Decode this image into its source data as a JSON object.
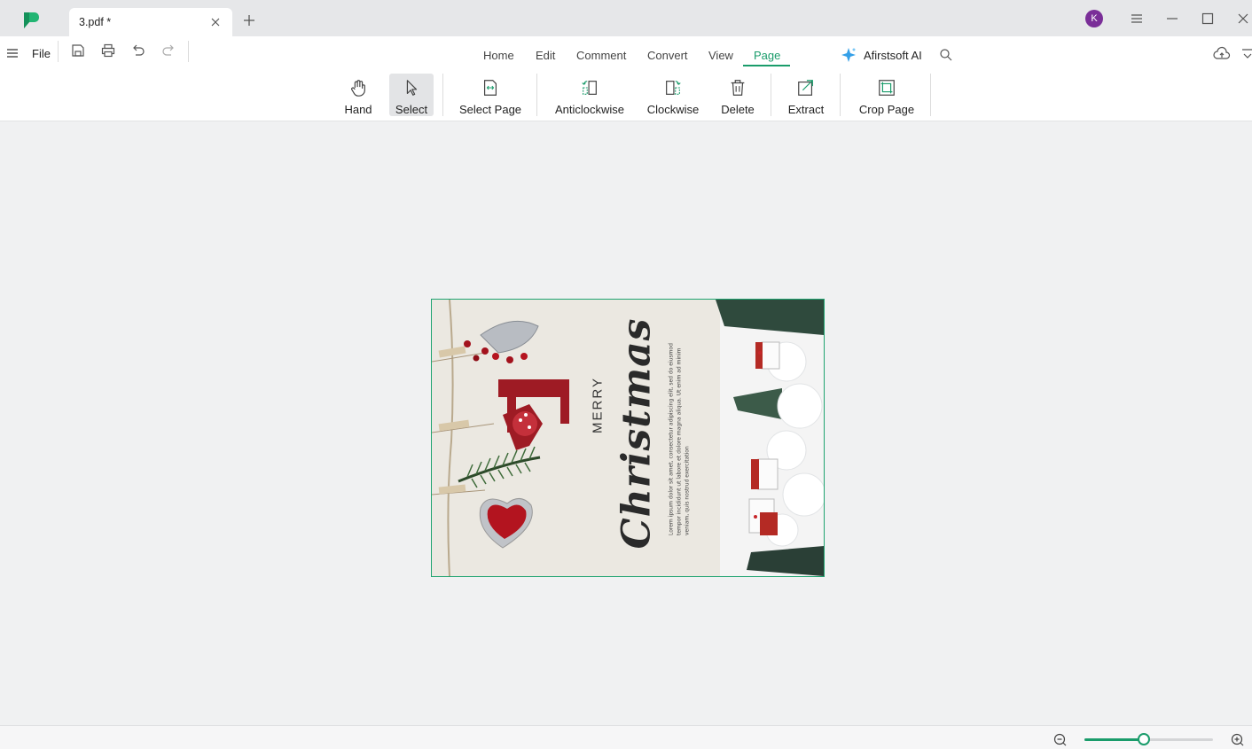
{
  "window": {
    "tab_title": "3.pdf *",
    "avatar_initial": "K",
    "avatar_color": "#7a2e98"
  },
  "menubar": {
    "file_label": "File",
    "tabs": [
      {
        "label": "Home",
        "active": false
      },
      {
        "label": "Edit",
        "active": false
      },
      {
        "label": "Comment",
        "active": false
      },
      {
        "label": "Convert",
        "active": false
      },
      {
        "label": "View",
        "active": false
      },
      {
        "label": "Page",
        "active": true
      }
    ],
    "ai_label": "Afirstsoft AI",
    "accent_color": "#1a9c6b"
  },
  "toolbar": {
    "tools": [
      {
        "label": "Hand",
        "icon": "hand-icon",
        "active": false
      },
      {
        "label": "Select",
        "icon": "cursor-icon",
        "active": true
      },
      {
        "label": "Select Page",
        "icon": "select-page-icon",
        "active": false
      },
      {
        "label": "Anticlockwise",
        "icon": "rotate-anticlockwise-icon",
        "active": false
      },
      {
        "label": "Clockwise",
        "icon": "rotate-clockwise-icon",
        "active": false
      },
      {
        "label": "Delete",
        "icon": "trash-icon",
        "active": false
      },
      {
        "label": "Extract",
        "icon": "extract-icon",
        "active": false
      },
      {
        "label": "Crop Page",
        "icon": "crop-icon",
        "active": false
      }
    ]
  },
  "document": {
    "card_heading_small": "MERRY",
    "card_heading_large": "Christmas",
    "card_body": "Lorem ipsum dolor sit amet, consectetur adipiscing elit, sed do eiusmod tempor incididunt ut labore et dolore magna aliqua. Ut enim ad minim veniam, quis nostrud exercitation"
  },
  "statusbar": {
    "zoom_level": 0.46
  }
}
